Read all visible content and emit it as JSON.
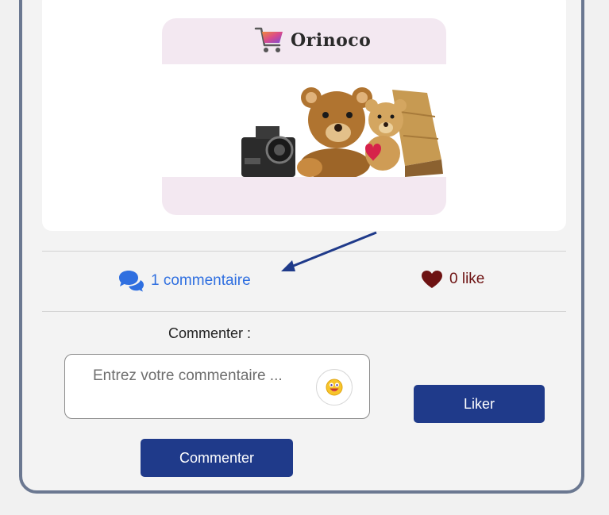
{
  "brand": {
    "name": "Orinoco"
  },
  "stats": {
    "comments_label": "1 commentaire",
    "likes_label": "0 like"
  },
  "comment_form": {
    "label": "Commenter :",
    "placeholder": "Entrez votre commentaire ...",
    "submit_label": "Commenter"
  },
  "like_button": {
    "label": "Liker"
  },
  "colors": {
    "accent": "#1f3a8a",
    "link": "#2f6fe0",
    "like": "#6d1212",
    "card_border": "#6b7891"
  },
  "icons": [
    "cart-icon",
    "comments-icon",
    "heart-icon",
    "emoji-icon"
  ]
}
